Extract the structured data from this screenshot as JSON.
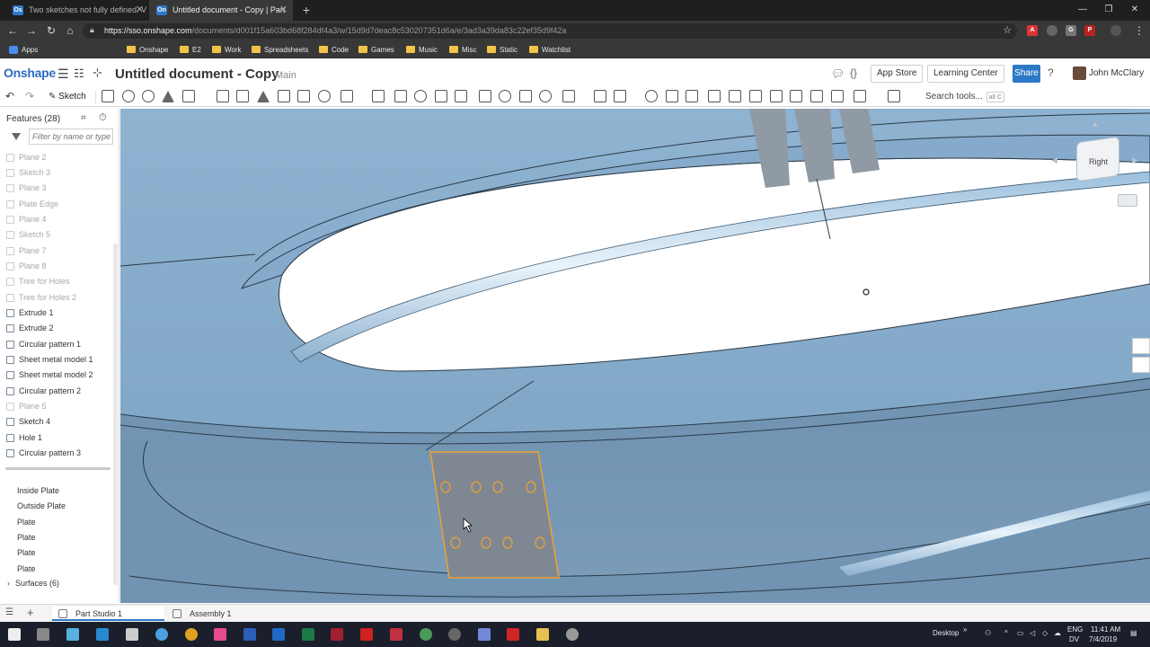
{
  "browser": {
    "tabs": [
      {
        "title": "Two sketches not fully defined. V",
        "favicon": "Os",
        "active": false
      },
      {
        "title": "Untitled document - Copy | Part",
        "favicon": "On",
        "active": true
      }
    ],
    "url_host": "https://sso.onshape.com",
    "url_path": "/documents/d001f15a603bd68f284df4a3/w/15d9d7deac8c530207351d6a/e/3ad3a39da83c22ef35d9f42a",
    "bookmarks": [
      {
        "label": "Apps",
        "kind": "apps"
      },
      {
        "label": "Onshape",
        "kind": "folder"
      },
      {
        "label": "E2",
        "kind": "folder"
      },
      {
        "label": "Work",
        "kind": "folder"
      },
      {
        "label": "Spreadsheets",
        "kind": "folder"
      },
      {
        "label": "Code",
        "kind": "folder"
      },
      {
        "label": "Games",
        "kind": "folder"
      },
      {
        "label": "Music",
        "kind": "folder"
      },
      {
        "label": "Misc",
        "kind": "folder"
      },
      {
        "label": "Static",
        "kind": "folder"
      },
      {
        "label": "Watchlist",
        "kind": "folder"
      }
    ]
  },
  "onshape": {
    "logo": "Onshape",
    "document_title": "Untitled document - Copy",
    "branch": "Main",
    "app_store": "App Store",
    "learning_center": "Learning Center",
    "share": "Share",
    "user": "John McClary",
    "sketch_label": "Sketch",
    "search_tools": "Search tools...",
    "search_shortcut": "alt C"
  },
  "features": {
    "header": "Features (28)",
    "filter_placeholder": "Filter by name or type",
    "items": [
      {
        "label": "Plane 2",
        "dim": true
      },
      {
        "label": "Sketch 3",
        "dim": true
      },
      {
        "label": "Plane 3",
        "dim": true
      },
      {
        "label": "Plate Edge",
        "dim": true
      },
      {
        "label": "Plane 4",
        "dim": true
      },
      {
        "label": "Sketch 5",
        "dim": true
      },
      {
        "label": "Plane 7",
        "dim": true
      },
      {
        "label": "Plane 8",
        "dim": true
      },
      {
        "label": "Tree for Holes",
        "dim": true
      },
      {
        "label": "Tree for Holes 2",
        "dim": true
      },
      {
        "label": "Extrude 1",
        "dim": false
      },
      {
        "label": "Extrude 2",
        "dim": false
      },
      {
        "label": "Circular pattern 1",
        "dim": false
      },
      {
        "label": "Sheet metal model 1",
        "dim": false
      },
      {
        "label": "Sheet metal model 2",
        "dim": false
      },
      {
        "label": "Circular pattern 2",
        "dim": false
      },
      {
        "label": "Plane 5",
        "dim": true
      },
      {
        "label": "Sketch 4",
        "dim": false
      },
      {
        "label": "Hole 1",
        "dim": false
      },
      {
        "label": "Circular pattern 3",
        "dim": false
      }
    ],
    "parts": [
      "Inside Plate",
      "Outside Plate",
      "Plate",
      "Plate",
      "Plate",
      "Plate"
    ],
    "surfaces": "Surfaces (6)"
  },
  "viewcube": {
    "label": "Right"
  },
  "bottom_tabs": [
    {
      "label": "Part Studio 1",
      "active": true
    },
    {
      "label": "Assembly 1",
      "active": false
    }
  ],
  "taskbar": {
    "desktop_label": "Desktop",
    "lang": "ENG",
    "lang2": "DV",
    "time": "11:41 AM",
    "date": "7/4/2019"
  },
  "colors": {
    "model_blue": "#7ea4c4",
    "selected_outline": "#f0a030",
    "onshape_blue": "#2e79c7"
  }
}
